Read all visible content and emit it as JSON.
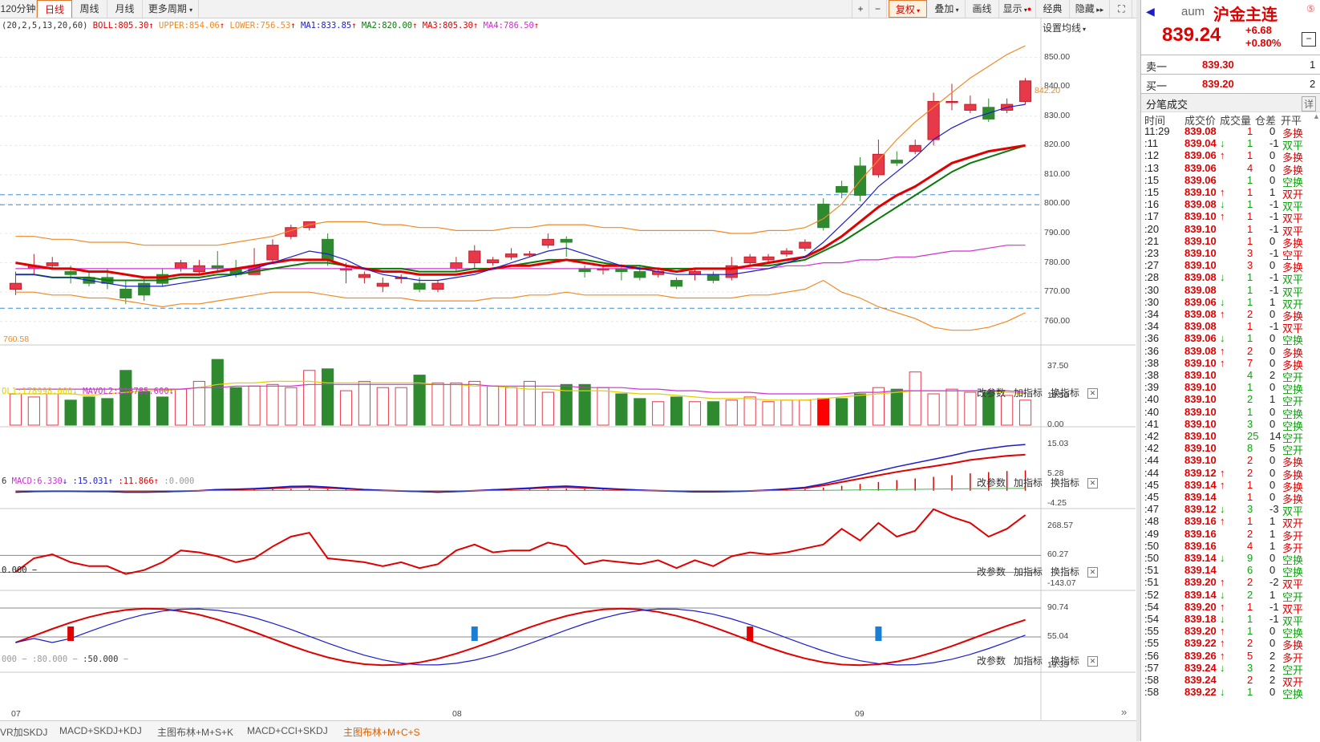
{
  "toolbar": {
    "period_120": "120分钟",
    "daily": "日线",
    "weekly": "周线",
    "monthly": "月线",
    "more_periods": "更多周期",
    "plus": "+",
    "minus": "−",
    "restore_rights": "复权",
    "overlay": "叠加",
    "draw": "画线",
    "display": "显示",
    "classic": "经典",
    "hide": "隐藏"
  },
  "main_legend": {
    "params": "(20,2,5,13,20,60)",
    "boll": "BOLL:805.30",
    "upper": "UPPER:854.06",
    "lower": "LOWER:756.53",
    "ma1": "MA1:833.85",
    "ma2": "MA2:820.00",
    "ma3": "MA3:805.30",
    "ma4": "MA4:786.50",
    "settings": "设置均线"
  },
  "price_axis": [
    "850.00",
    "840.00",
    "830.00",
    "820.00",
    "810.00",
    "800.00",
    "790.00",
    "780.00",
    "770.00",
    "760.00"
  ],
  "price_notes": {
    "high_marker": "842.20",
    "low_marker": "760.58"
  },
  "panel_tools": {
    "edit_params": "改参数",
    "add_indicator": "加指标",
    "switch_indicator": "换指标",
    "close": "✕"
  },
  "volume_panel": {
    "legend_vol": "OL1:178998.000",
    "legend_mavol2": "MAVOL2:216785.600",
    "axis": [
      "37.50",
      "18.50",
      "0.00"
    ]
  },
  "macd_panel": {
    "legend_prefix": "6",
    "macd": "MACD:6.330",
    "dif": ":15.031",
    "dea": ":11.866",
    "zero": ":0.000",
    "axis": [
      "15.03",
      "5.28",
      "-4.25"
    ]
  },
  "cci_panel": {
    "legend": "0.000 −",
    "axis": [
      "268.57",
      "60.27",
      "-143.07"
    ]
  },
  "kdj_panel": {
    "legend_a": "000",
    "legend_b": ":80.000",
    "legend_c": ":50.000",
    "axis": [
      "90.74",
      "55.04",
      "19.33"
    ]
  },
  "x_axis": [
    "07",
    "08",
    "09"
  ],
  "bottom_tabs": [
    "VR加SKDJ",
    "MACD+SKDJ+KDJ",
    "主图布林+M+S+K",
    "MACD+CCI+SKDJ",
    "主图布林+M+C+S"
  ],
  "quote": {
    "code": "aum",
    "name": "沪金主连",
    "price": "839.24",
    "change": "+6.68",
    "change_pct": "+0.80%",
    "sell1_label": "卖一",
    "sell1_price": "839.30",
    "sell1_vol": "1",
    "buy1_label": "买一",
    "buy1_price": "839.20",
    "buy1_vol": "2",
    "trades_title": "分笔成交",
    "trades_detail": "详",
    "col_time": "时间",
    "col_price": "成交价",
    "col_vol": "成交量",
    "col_oi": "仓差",
    "col_type": "开平"
  },
  "trades": [
    {
      "t": "11:29",
      "p": "839.08",
      "a": "",
      "v": "1",
      "o": "0",
      "k": "多换",
      "c": "red"
    },
    {
      "t": ":11",
      "p": "839.04",
      "a": "↓",
      "v": "1",
      "o": "-1",
      "k": "双平",
      "c": "green"
    },
    {
      "t": ":12",
      "p": "839.06",
      "a": "↑",
      "v": "1",
      "o": "0",
      "k": "多换",
      "c": "red"
    },
    {
      "t": ":13",
      "p": "839.06",
      "a": "",
      "v": "4",
      "o": "0",
      "k": "多换",
      "c": "red"
    },
    {
      "t": ":15",
      "p": "839.06",
      "a": "",
      "v": "1",
      "o": "0",
      "k": "空换",
      "c": "green"
    },
    {
      "t": ":15",
      "p": "839.10",
      "a": "↑",
      "v": "1",
      "o": "1",
      "k": "双开",
      "c": "red"
    },
    {
      "t": ":16",
      "p": "839.08",
      "a": "↓",
      "v": "1",
      "o": "-1",
      "k": "双平",
      "c": "green"
    },
    {
      "t": ":17",
      "p": "839.10",
      "a": "↑",
      "v": "1",
      "o": "-1",
      "k": "双平",
      "c": "red"
    },
    {
      "t": ":20",
      "p": "839.10",
      "a": "",
      "v": "1",
      "o": "-1",
      "k": "双平",
      "c": "red"
    },
    {
      "t": ":21",
      "p": "839.10",
      "a": "",
      "v": "1",
      "o": "0",
      "k": "多换",
      "c": "red"
    },
    {
      "t": ":23",
      "p": "839.10",
      "a": "",
      "v": "3",
      "o": "-1",
      "k": "空平",
      "c": "red"
    },
    {
      "t": ":27",
      "p": "839.10",
      "a": "",
      "v": "3",
      "o": "0",
      "k": "多换",
      "c": "red"
    },
    {
      "t": ":28",
      "p": "839.08",
      "a": "↓",
      "v": "1",
      "o": "-1",
      "k": "双平",
      "c": "green"
    },
    {
      "t": ":30",
      "p": "839.08",
      "a": "",
      "v": "1",
      "o": "-1",
      "k": "双平",
      "c": "green"
    },
    {
      "t": ":30",
      "p": "839.06",
      "a": "↓",
      "v": "1",
      "o": "1",
      "k": "双开",
      "c": "green"
    },
    {
      "t": ":34",
      "p": "839.08",
      "a": "↑",
      "v": "2",
      "o": "0",
      "k": "多换",
      "c": "red"
    },
    {
      "t": ":34",
      "p": "839.08",
      "a": "",
      "v": "1",
      "o": "-1",
      "k": "双平",
      "c": "red"
    },
    {
      "t": ":36",
      "p": "839.06",
      "a": "↓",
      "v": "1",
      "o": "0",
      "k": "空换",
      "c": "green"
    },
    {
      "t": ":36",
      "p": "839.08",
      "a": "↑",
      "v": "2",
      "o": "0",
      "k": "多换",
      "c": "red"
    },
    {
      "t": ":38",
      "p": "839.10",
      "a": "↑",
      "v": "7",
      "o": "0",
      "k": "多换",
      "c": "red"
    },
    {
      "t": ":38",
      "p": "839.10",
      "a": "",
      "v": "4",
      "o": "2",
      "k": "空开",
      "c": "green"
    },
    {
      "t": ":39",
      "p": "839.10",
      "a": "",
      "v": "1",
      "o": "0",
      "k": "空换",
      "c": "green"
    },
    {
      "t": ":40",
      "p": "839.10",
      "a": "",
      "v": "2",
      "o": "1",
      "k": "空开",
      "c": "green"
    },
    {
      "t": ":40",
      "p": "839.10",
      "a": "",
      "v": "1",
      "o": "0",
      "k": "空换",
      "c": "green"
    },
    {
      "t": ":41",
      "p": "839.10",
      "a": "",
      "v": "3",
      "o": "0",
      "k": "空换",
      "c": "green"
    },
    {
      "t": ":42",
      "p": "839.10",
      "a": "",
      "v": "25",
      "o": "14",
      "k": "空开",
      "c": "green"
    },
    {
      "t": ":42",
      "p": "839.10",
      "a": "",
      "v": "8",
      "o": "5",
      "k": "空开",
      "c": "green"
    },
    {
      "t": ":44",
      "p": "839.10",
      "a": "",
      "v": "2",
      "o": "0",
      "k": "多换",
      "c": "red"
    },
    {
      "t": ":44",
      "p": "839.12",
      "a": "↑",
      "v": "2",
      "o": "0",
      "k": "多换",
      "c": "red"
    },
    {
      "t": ":45",
      "p": "839.14",
      "a": "↑",
      "v": "1",
      "o": "0",
      "k": "多换",
      "c": "red"
    },
    {
      "t": ":45",
      "p": "839.14",
      "a": "",
      "v": "1",
      "o": "0",
      "k": "多换",
      "c": "red"
    },
    {
      "t": ":47",
      "p": "839.12",
      "a": "↓",
      "v": "3",
      "o": "-3",
      "k": "双平",
      "c": "green"
    },
    {
      "t": ":48",
      "p": "839.16",
      "a": "↑",
      "v": "1",
      "o": "1",
      "k": "双开",
      "c": "red"
    },
    {
      "t": ":49",
      "p": "839.16",
      "a": "",
      "v": "2",
      "o": "1",
      "k": "多开",
      "c": "red"
    },
    {
      "t": ":50",
      "p": "839.16",
      "a": "",
      "v": "4",
      "o": "1",
      "k": "多开",
      "c": "red"
    },
    {
      "t": ":50",
      "p": "839.14",
      "a": "↓",
      "v": "9",
      "o": "0",
      "k": "空换",
      "c": "green"
    },
    {
      "t": ":51",
      "p": "839.14",
      "a": "",
      "v": "6",
      "o": "0",
      "k": "空换",
      "c": "green"
    },
    {
      "t": ":51",
      "p": "839.20",
      "a": "↑",
      "v": "2",
      "o": "-2",
      "k": "双平",
      "c": "red"
    },
    {
      "t": ":52",
      "p": "839.14",
      "a": "↓",
      "v": "2",
      "o": "1",
      "k": "空开",
      "c": "green"
    },
    {
      "t": ":54",
      "p": "839.20",
      "a": "↑",
      "v": "1",
      "o": "-1",
      "k": "双平",
      "c": "red"
    },
    {
      "t": ":54",
      "p": "839.18",
      "a": "↓",
      "v": "1",
      "o": "-1",
      "k": "双平",
      "c": "green"
    },
    {
      "t": ":55",
      "p": "839.20",
      "a": "↑",
      "v": "1",
      "o": "0",
      "k": "空换",
      "c": "green"
    },
    {
      "t": ":55",
      "p": "839.22",
      "a": "↑",
      "v": "2",
      "o": "0",
      "k": "多换",
      "c": "red"
    },
    {
      "t": ":56",
      "p": "839.26",
      "a": "↑",
      "v": "5",
      "o": "2",
      "k": "多开",
      "c": "red"
    },
    {
      "t": ":57",
      "p": "839.24",
      "a": "↓",
      "v": "3",
      "o": "2",
      "k": "空开",
      "c": "green"
    },
    {
      "t": ":58",
      "p": "839.24",
      "a": "",
      "v": "2",
      "o": "2",
      "k": "双开",
      "c": "red"
    },
    {
      "t": ":58",
      "p": "839.22",
      "a": "↓",
      "v": "1",
      "o": "0",
      "k": "空换",
      "c": "green"
    }
  ],
  "chart_data": {
    "type": "candlestick",
    "ylim": [
      752,
      857
    ],
    "candles": [
      [
        771,
        773,
        769,
        777
      ],
      [
        778,
        779,
        776,
        783
      ],
      [
        779,
        780,
        778,
        782
      ],
      [
        777,
        776,
        773,
        779
      ],
      [
        775,
        773,
        772,
        777
      ],
      [
        775,
        773,
        771,
        778
      ],
      [
        771,
        768,
        766,
        774
      ],
      [
        773,
        769,
        767,
        775
      ],
      [
        776,
        773,
        772,
        778
      ],
      [
        778,
        780,
        777,
        781
      ],
      [
        777,
        779,
        776,
        781
      ],
      [
        779,
        778,
        777,
        784
      ],
      [
        778,
        776,
        775,
        781
      ],
      [
        776,
        779,
        776,
        785
      ],
      [
        781,
        786,
        780,
        788
      ],
      [
        789,
        792,
        788,
        793
      ],
      [
        792,
        794,
        791,
        794
      ],
      [
        788,
        781,
        779,
        790
      ],
      [
        778,
        778,
        773,
        780
      ],
      [
        775,
        776,
        773,
        777
      ],
      [
        772,
        773,
        770,
        775
      ],
      [
        775,
        775,
        773,
        776
      ],
      [
        773,
        771,
        770,
        775
      ],
      [
        771,
        773,
        770,
        774
      ],
      [
        778,
        780,
        777,
        782
      ],
      [
        780,
        784,
        778,
        786
      ],
      [
        780,
        781,
        779,
        782
      ],
      [
        782,
        783,
        781,
        785
      ],
      [
        783,
        783,
        782,
        784
      ],
      [
        786,
        788,
        785,
        790
      ],
      [
        788,
        787,
        782,
        789
      ],
      [
        778,
        777,
        775,
        779
      ],
      [
        778,
        778,
        776,
        779
      ],
      [
        778,
        777,
        774,
        779
      ],
      [
        777,
        775,
        774,
        779
      ],
      [
        776,
        777,
        775,
        778
      ],
      [
        774,
        772,
        771,
        775
      ],
      [
        776,
        777,
        774,
        778
      ],
      [
        776,
        774,
        773,
        777
      ],
      [
        775,
        779,
        774,
        782
      ],
      [
        780,
        782,
        779,
        783
      ],
      [
        781,
        782,
        780,
        783
      ],
      [
        783,
        784,
        782,
        785
      ],
      [
        785,
        787,
        784,
        788
      ],
      [
        800,
        792,
        791,
        802
      ],
      [
        806,
        804,
        802,
        808
      ],
      [
        813,
        803,
        801,
        816
      ],
      [
        810,
        817,
        809,
        822
      ],
      [
        815,
        814,
        813,
        818
      ],
      [
        818,
        820,
        817,
        822
      ],
      [
        822,
        835,
        820,
        838
      ],
      [
        835,
        835,
        832,
        841
      ],
      [
        832,
        834,
        831,
        837
      ],
      [
        833,
        829,
        828,
        836
      ],
      [
        832,
        834,
        831,
        836
      ],
      [
        835,
        842,
        834,
        843
      ]
    ],
    "boll_mid": [
      780,
      779,
      778,
      778,
      777,
      777,
      776,
      775,
      775,
      776,
      776,
      777,
      778,
      779,
      780,
      781,
      781,
      781,
      779,
      778,
      777,
      777,
      776,
      776,
      776,
      777,
      778,
      779,
      779,
      780,
      781,
      780,
      779,
      779,
      778,
      778,
      777,
      778,
      778,
      778,
      779,
      780,
      781,
      782,
      785,
      789,
      794,
      799,
      803,
      806,
      810,
      814,
      816,
      818,
      819,
      820
    ],
    "upper": [
      789,
      789,
      788,
      788,
      787,
      787,
      787,
      786,
      786,
      786,
      786,
      786,
      787,
      788,
      789,
      791,
      793,
      794,
      794,
      794,
      793,
      793,
      792,
      792,
      791,
      791,
      791,
      792,
      792,
      793,
      793,
      793,
      792,
      792,
      791,
      791,
      791,
      791,
      791,
      790,
      790,
      791,
      791,
      792,
      795,
      800,
      808,
      815,
      822,
      828,
      833,
      838,
      843,
      847,
      851,
      854
    ],
    "lower": [
      770,
      770,
      769,
      769,
      768,
      768,
      767,
      766,
      765,
      766,
      766,
      767,
      768,
      769,
      770,
      770,
      770,
      769,
      768,
      768,
      768,
      768,
      767,
      767,
      767,
      767,
      768,
      768,
      769,
      769,
      770,
      769,
      769,
      769,
      769,
      769,
      768,
      768,
      768,
      768,
      769,
      769,
      770,
      771,
      774,
      770,
      768,
      765,
      763,
      761,
      758,
      757,
      757,
      758,
      760,
      763
    ],
    "ma_blue": [
      776,
      776,
      775,
      775,
      774,
      773,
      772,
      772,
      772,
      773,
      774,
      775,
      776,
      778,
      780,
      782,
      784,
      783,
      781,
      778,
      776,
      775,
      774,
      774,
      775,
      776,
      778,
      780,
      782,
      784,
      785,
      783,
      781,
      779,
      778,
      777,
      776,
      776,
      776,
      776,
      777,
      778,
      780,
      782,
      787,
      793,
      799,
      806,
      811,
      816,
      822,
      826,
      829,
      831,
      833,
      834
    ],
    "ma_green": [
      776,
      776,
      775,
      775,
      775,
      774,
      774,
      774,
      774,
      775,
      775,
      776,
      776,
      777,
      778,
      779,
      780,
      780,
      779,
      778,
      778,
      778,
      777,
      777,
      777,
      778,
      778,
      779,
      780,
      781,
      781,
      781,
      780,
      779,
      779,
      778,
      778,
      778,
      778,
      778,
      779,
      779,
      780,
      781,
      784,
      787,
      791,
      795,
      799,
      803,
      807,
      811,
      814,
      816,
      818,
      820
    ],
    "ma_red": [
      780,
      779,
      778,
      778,
      777,
      777,
      776,
      776,
      776,
      776,
      777,
      777,
      778,
      778,
      779,
      779,
      779,
      779,
      779,
      778,
      778,
      778,
      778,
      777,
      777,
      778,
      778,
      778,
      779,
      779,
      779,
      779,
      779,
      779,
      778,
      778,
      778,
      778,
      778,
      778,
      779,
      779,
      779,
      780,
      781,
      783,
      785,
      787,
      789,
      792,
      795,
      798,
      800,
      802,
      804,
      805
    ],
    "ma_magenta": [
      778,
      778,
      778,
      778,
      778,
      778,
      778,
      778,
      778,
      778,
      778,
      778,
      778,
      778,
      778,
      778,
      778,
      778,
      778,
      778,
      778,
      778,
      778,
      778,
      778,
      778,
      778,
      778,
      778,
      778,
      778,
      778,
      778,
      778,
      778,
      778,
      778,
      778,
      778,
      778,
      778,
      778,
      779,
      779,
      780,
      780,
      781,
      781,
      782,
      782,
      783,
      784,
      784,
      785,
      786,
      786
    ],
    "volume": [
      20,
      18,
      20,
      16,
      18,
      17,
      35,
      22,
      18,
      23,
      28,
      42,
      24,
      25,
      26,
      24,
      35,
      36,
      22,
      28,
      24,
      24,
      32,
      27,
      27,
      28,
      25,
      24,
      28,
      21,
      26,
      26,
      24,
      20,
      17,
      15,
      18,
      15,
      15,
      16,
      18,
      15,
      16,
      16,
      17,
      17,
      20,
      24,
      23,
      34,
      20,
      23,
      21,
      21,
      19,
      16
    ],
    "mavol_yellow": [
      20,
      20,
      20,
      20,
      19,
      20,
      21,
      22,
      22,
      23,
      24,
      26,
      27,
      27,
      28,
      28,
      28,
      27,
      27,
      27,
      27,
      27,
      27,
      26,
      26,
      25,
      25,
      24,
      23,
      23,
      22,
      22,
      22,
      21,
      20,
      20,
      19,
      18,
      17,
      17,
      17,
      16,
      16,
      16,
      17,
      18,
      19,
      20,
      21,
      22,
      22,
      22,
      22,
      22,
      21,
      20
    ],
    "mavol_magenta": [
      23,
      23,
      23,
      23,
      23,
      23,
      23,
      23,
      23,
      23,
      24,
      24,
      25,
      25,
      25,
      25,
      26,
      26,
      26,
      26,
      26,
      26,
      26,
      26,
      26,
      26,
      25,
      25,
      25,
      25,
      25,
      24,
      24,
      24,
      23,
      23,
      22,
      22,
      21,
      21,
      21,
      20,
      20,
      20,
      20,
      20,
      21,
      21,
      22,
      22,
      22,
      22,
      22,
      22,
      22,
      21
    ],
    "macd_dif": [
      -0.5,
      -0.3,
      -0.2,
      -0.2,
      -0.3,
      -0.3,
      -0.5,
      -0.5,
      -0.4,
      -0.2,
      0,
      0.4,
      0.5,
      0.7,
      1,
      1.4,
      1.5,
      1.2,
      0.8,
      0.4,
      0.1,
      -0.1,
      -0.3,
      -0.5,
      -0.3,
      0,
      0.3,
      0.6,
      0.9,
      1.3,
      1.5,
      1.2,
      0.8,
      0.5,
      0.2,
      0,
      -0.2,
      -0.4,
      -0.4,
      -0.3,
      -0.1,
      0.2,
      0.6,
      1.1,
      2.2,
      3.6,
      5,
      6.4,
      7.8,
      9,
      10.2,
      11.4,
      12.8,
      13.7,
      14.5,
      15
    ]
  }
}
